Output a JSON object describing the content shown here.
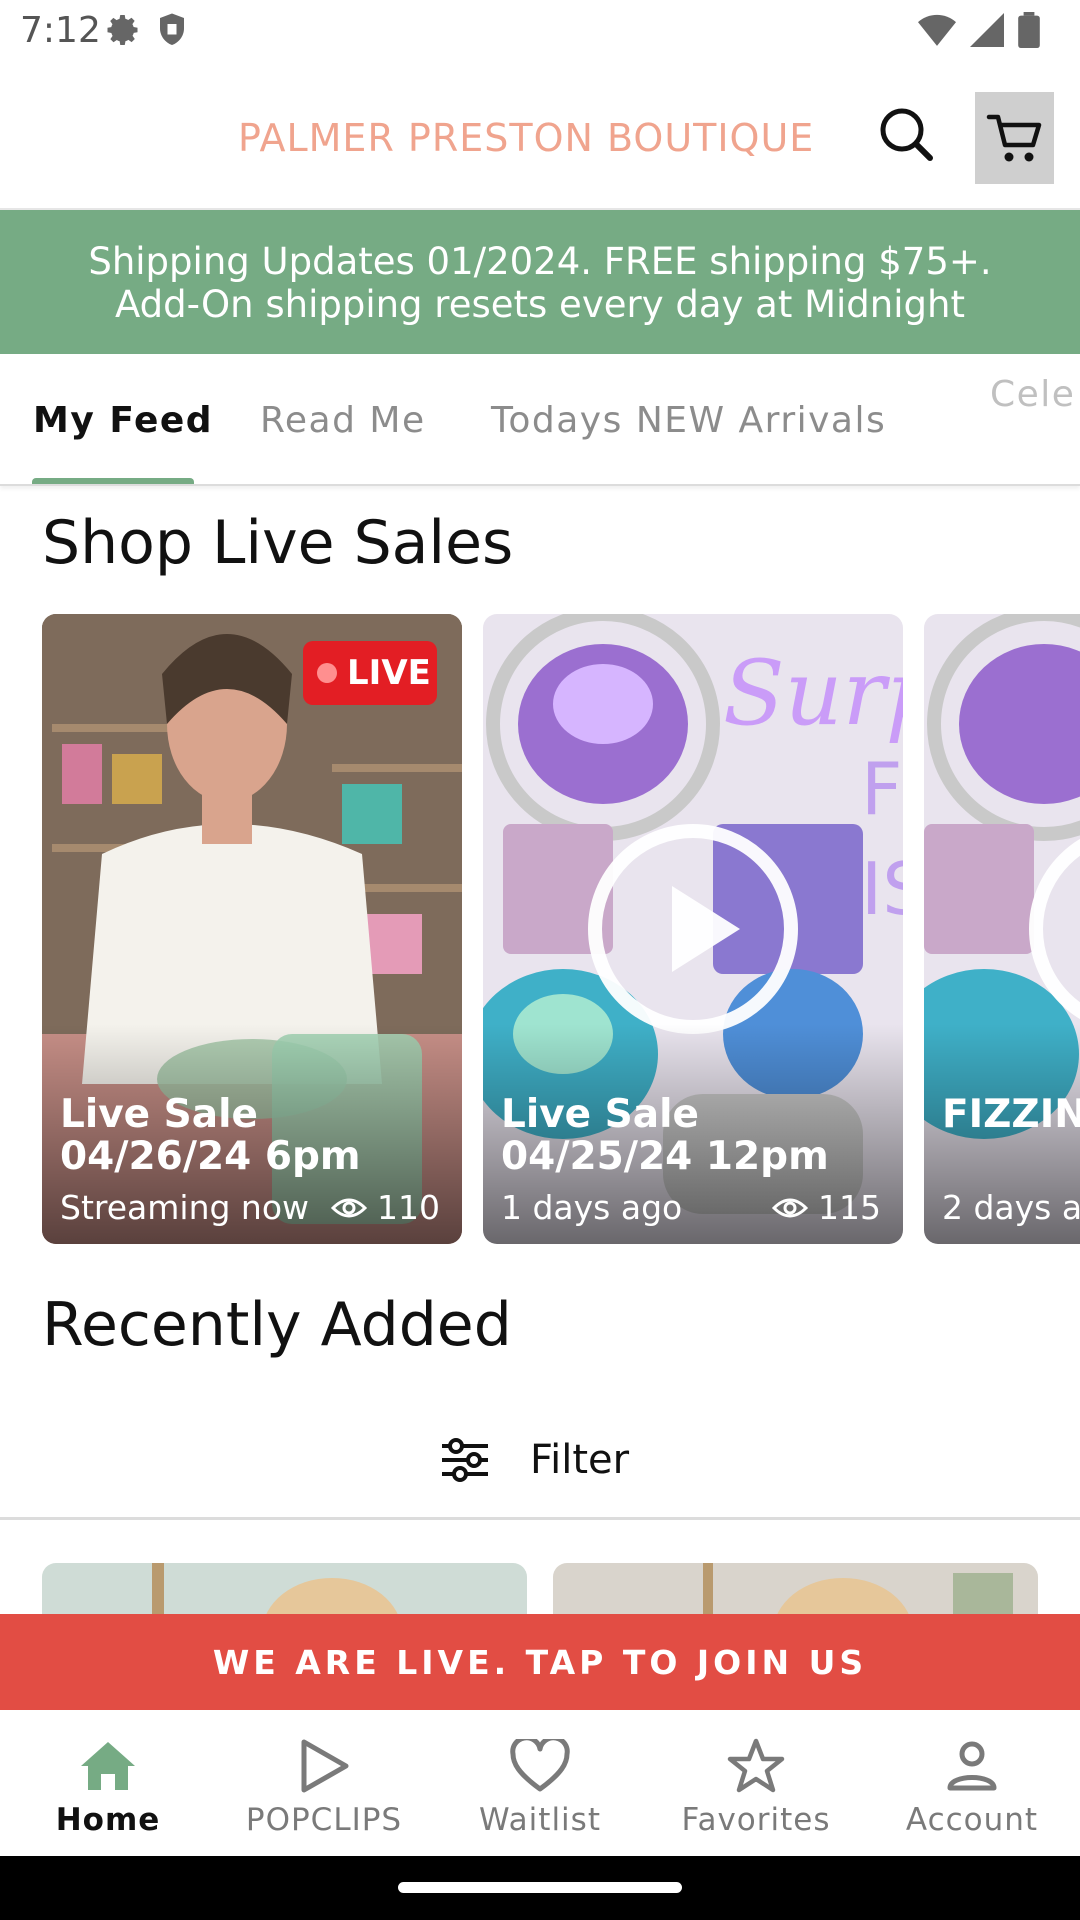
{
  "status_bar": {
    "time": "7:12",
    "icons": [
      "settings-icon",
      "shield-icon",
      "wifi-icon",
      "signal-icon",
      "battery-icon"
    ]
  },
  "header": {
    "brand": "PALMER PRESTON BOUTIQUE",
    "brand_color": "#f0a48e",
    "icons": [
      "search-icon",
      "cart-icon"
    ]
  },
  "promo": {
    "line1": "Shipping Updates 01/2024. FREE shipping $75+.",
    "line2": "Add-On shipping resets every day at Midnight",
    "background": "#76ab84"
  },
  "tabs": [
    {
      "label": "My Feed",
      "active": true
    },
    {
      "label": "Read Me",
      "active": false
    },
    {
      "label": "Todays NEW Arrivals",
      "active": false
    },
    {
      "label": "Cele",
      "active": false
    }
  ],
  "live_section": {
    "title": "Shop Live Sales",
    "cards": [
      {
        "title": "Live Sale 04/26/24 6pm",
        "meta": "Streaming now",
        "views": "110",
        "badge": "LIVE"
      },
      {
        "title": "Live Sale 04/25/24 12pm",
        "meta": "1 days ago",
        "views": "115",
        "image_text": "Surp",
        "image_side_text": "FI IS"
      },
      {
        "title": "FIZZIN restock",
        "meta": "2 days a"
      }
    ]
  },
  "recent_section": {
    "title": "Recently Added",
    "filter_label": "Filter"
  },
  "live_banner": {
    "text": "WE ARE LIVE. TAP TO JOIN US",
    "background": "#e24d44"
  },
  "bottom_nav": [
    {
      "label": "Home",
      "icon": "home-icon",
      "active": true
    },
    {
      "label": "POPCLIPS",
      "icon": "play-icon",
      "active": false
    },
    {
      "label": "Waitlist",
      "icon": "heart-icon",
      "active": false
    },
    {
      "label": "Favorites",
      "icon": "star-icon",
      "active": false
    },
    {
      "label": "Account",
      "icon": "person-icon",
      "active": false
    }
  ],
  "accent_color": "#76ab84"
}
